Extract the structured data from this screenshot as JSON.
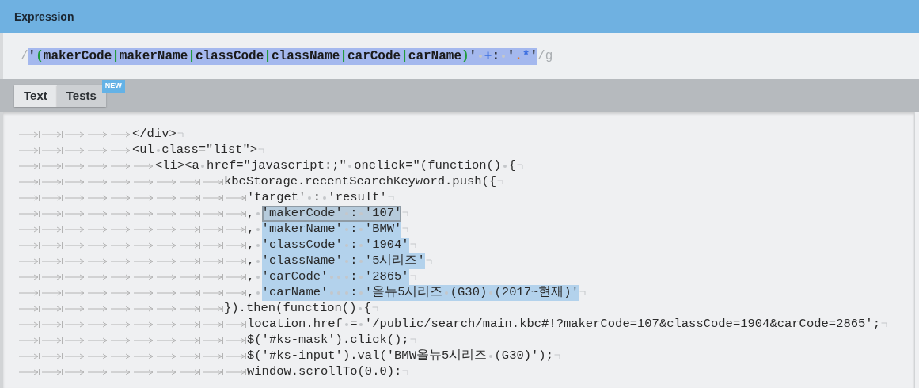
{
  "header": {
    "title": "Expression"
  },
  "expression": {
    "open": "/",
    "tokens": [
      {
        "kind": "literal",
        "text": "'"
      },
      {
        "kind": "group",
        "text": "("
      },
      {
        "kind": "literal",
        "text": "makerCode"
      },
      {
        "kind": "group",
        "text": "|"
      },
      {
        "kind": "literal",
        "text": "makerName"
      },
      {
        "kind": "group",
        "text": "|"
      },
      {
        "kind": "literal",
        "text": "classCode"
      },
      {
        "kind": "group",
        "text": "|"
      },
      {
        "kind": "literal",
        "text": "className"
      },
      {
        "kind": "group",
        "text": "|"
      },
      {
        "kind": "literal",
        "text": "carCode"
      },
      {
        "kind": "group",
        "text": "|"
      },
      {
        "kind": "literal",
        "text": "carName"
      },
      {
        "kind": "group",
        "text": ")"
      },
      {
        "kind": "literal",
        "text": "' "
      },
      {
        "kind": "quantifier",
        "text": "+"
      },
      {
        "kind": "literal",
        "text": ": '"
      },
      {
        "kind": "dot",
        "text": "."
      },
      {
        "kind": "quantifier",
        "text": "*"
      },
      {
        "kind": "literal",
        "text": "'"
      }
    ],
    "close": "/g"
  },
  "tabs": [
    {
      "label": "Text",
      "selected": true
    },
    {
      "label": "Tests",
      "selected": false,
      "badge": "NEW"
    }
  ],
  "lines": [
    {
      "segments": [
        {
          "kind": "plain",
          "text": "\t\t\t\t\t</div>"
        }
      ]
    },
    {
      "segments": [
        {
          "kind": "plain",
          "text": "\t\t\t\t\t<ul class=\"list\">"
        }
      ]
    },
    {
      "segments": [
        {
          "kind": "plain",
          "text": "\t\t\t\t\t\t<li><a href=\"javascript:;\" onclick=\"(function() {"
        }
      ]
    },
    {
      "segments": [
        {
          "kind": "plain",
          "text": "\t\t\t\t\t\t\t\t\tkbcStorage.recentSearchKeyword.push({"
        }
      ]
    },
    {
      "segments": [
        {
          "kind": "plain",
          "text": "\t\t\t\t\t\t\t\t\t\t'target' : 'result'"
        }
      ]
    },
    {
      "segments": [
        {
          "kind": "plain",
          "text": "\t\t\t\t\t\t\t\t\t\t, "
        },
        {
          "kind": "match",
          "selected": true,
          "text": "'makerCode' : '107'"
        }
      ]
    },
    {
      "segments": [
        {
          "kind": "plain",
          "text": "\t\t\t\t\t\t\t\t\t\t, "
        },
        {
          "kind": "match",
          "selected": false,
          "text": "'makerName' : 'BMW'"
        }
      ]
    },
    {
      "segments": [
        {
          "kind": "plain",
          "text": "\t\t\t\t\t\t\t\t\t\t, "
        },
        {
          "kind": "match",
          "selected": false,
          "text": "'classCode' : '1904'"
        }
      ]
    },
    {
      "segments": [
        {
          "kind": "plain",
          "text": "\t\t\t\t\t\t\t\t\t\t, "
        },
        {
          "kind": "match",
          "selected": false,
          "text": "'className' : '5시리즈'"
        }
      ]
    },
    {
      "segments": [
        {
          "kind": "plain",
          "text": "\t\t\t\t\t\t\t\t\t\t, "
        },
        {
          "kind": "match",
          "selected": false,
          "text": "'carCode'   : '2865'"
        }
      ]
    },
    {
      "segments": [
        {
          "kind": "plain",
          "text": "\t\t\t\t\t\t\t\t\t\t, "
        },
        {
          "kind": "match",
          "selected": false,
          "text": "'carName'   : '올뉴5시리즈 (G30) (2017~현재)'"
        }
      ]
    },
    {
      "segments": [
        {
          "kind": "plain",
          "text": "\t\t\t\t\t\t\t\t\t}).then(function() {"
        }
      ]
    },
    {
      "segments": [
        {
          "kind": "plain",
          "text": "\t\t\t\t\t\t\t\t\t\tlocation.href = '/public/search/main.kbc#!?makerCode=107&classCode=1904&carCode=2865';"
        }
      ]
    },
    {
      "segments": [
        {
          "kind": "plain",
          "text": "\t\t\t\t\t\t\t\t\t\t$('#ks-mask').click();"
        }
      ]
    },
    {
      "segments": [
        {
          "kind": "plain",
          "text": "\t\t\t\t\t\t\t\t\t\t$('#ks-input').val('BMW올뉴5시리즈 (G30)');"
        }
      ]
    },
    {
      "segments": [
        {
          "kind": "plain",
          "text": "\t\t\t\t\t\t\t\t\t\twindow.scrollTo(0.0):"
        }
      ]
    }
  ]
}
